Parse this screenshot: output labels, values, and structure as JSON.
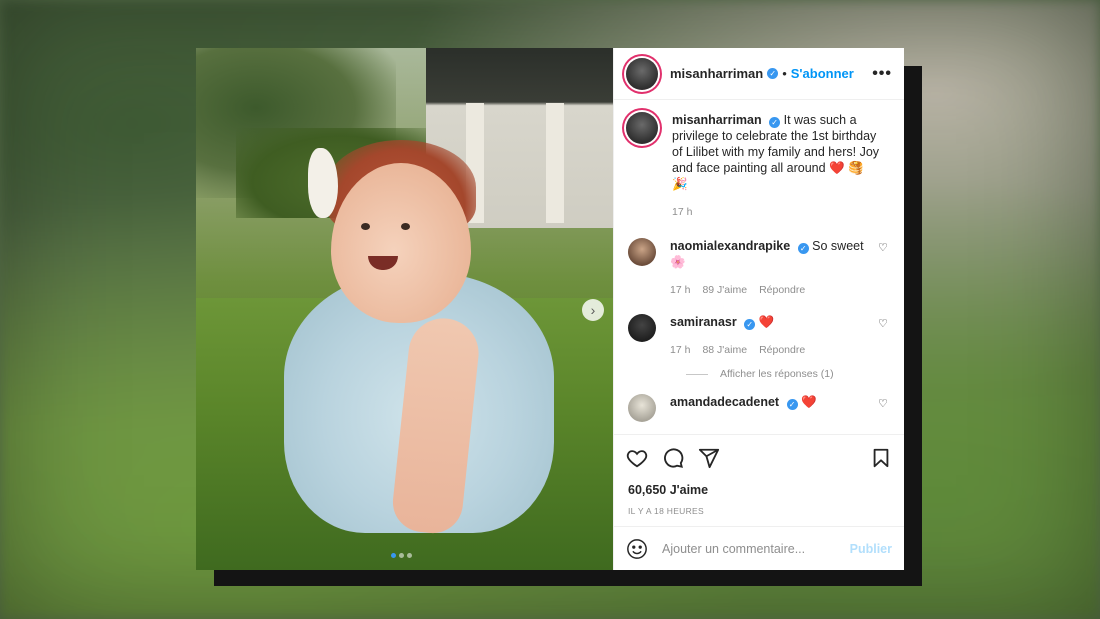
{
  "post": {
    "author": "misanharriman",
    "follow_label": "S'abonner",
    "more_label": "•••",
    "caption": {
      "username": "misanharriman",
      "text": "It was such a privilege to celebrate the 1st birthday of Lilibet with my family and hers! Joy and face painting all around",
      "emojis": "❤️ 🥞 🎉",
      "time": "17 h"
    },
    "comments": [
      {
        "username": "naomialexandrapike",
        "text": "So sweet",
        "emoji": "🌸",
        "time": "17 h",
        "likes": "89 J'aime",
        "reply": "Répondre"
      },
      {
        "username": "samiranasr",
        "text": "",
        "emoji": "❤️",
        "time": "17 h",
        "likes": "88 J'aime",
        "reply": "Répondre",
        "view_replies": "Afficher les réponses (1)"
      },
      {
        "username": "amandadecadenet",
        "text": "",
        "emoji": "❤️"
      }
    ],
    "likes_count": "60,650 J'aime",
    "posted_ago": "IL Y A 18 HEURES",
    "add_comment_placeholder": "Ajouter un commentaire...",
    "publish_label": "Publier",
    "carousel": {
      "next": "›",
      "slides": 3,
      "active": 1
    }
  },
  "colors": {
    "accent": "#0095f6",
    "verified": "#3897f0",
    "heart": "#e0245e"
  },
  "icons": [
    "verified-icon",
    "more-icon",
    "heart-icon",
    "comment-icon",
    "share-icon",
    "bookmark-icon",
    "emoji-icon",
    "next-arrow-icon"
  ]
}
